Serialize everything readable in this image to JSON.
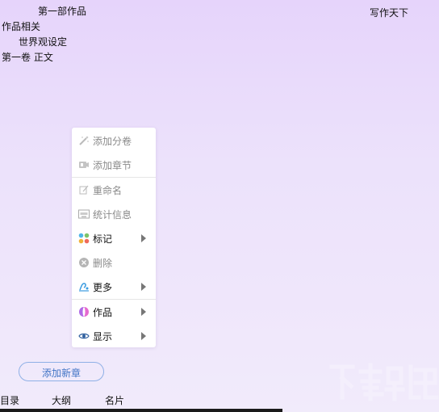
{
  "header": {
    "book_title": "第一部作品",
    "app_name": "写作天下"
  },
  "tree": {
    "items": [
      {
        "label": "作品相关"
      },
      {
        "label": "世界观设定"
      },
      {
        "label": "第一卷 正文"
      }
    ]
  },
  "context_menu": {
    "items": [
      {
        "label": "添加分卷",
        "icon": "add-volume-icon",
        "enabled": false
      },
      {
        "label": "添加章节",
        "icon": "add-chapter-icon",
        "enabled": false
      },
      {
        "label": "重命名",
        "icon": "rename-icon",
        "enabled": false
      },
      {
        "label": "统计信息",
        "icon": "statistics-icon",
        "enabled": false
      },
      {
        "label": "标记",
        "icon": "color-dots-icon",
        "enabled": true,
        "submenu": true
      },
      {
        "label": "删除",
        "icon": "delete-icon",
        "enabled": false
      },
      {
        "label": "更多",
        "icon": "more-icon",
        "enabled": true,
        "submenu": true
      },
      {
        "label": "作品",
        "icon": "works-icon",
        "enabled": true,
        "submenu": true
      },
      {
        "label": "显示",
        "icon": "eye-icon",
        "enabled": true,
        "submenu": true
      }
    ]
  },
  "actions": {
    "add_chapter_button": "添加新章"
  },
  "bottom_tabs": [
    {
      "label": "目录"
    },
    {
      "label": "大纲"
    },
    {
      "label": "名片"
    }
  ],
  "colors": {
    "accent": "#3f73c5",
    "background_top": "#e6d4fb",
    "background_bottom": "#f1ebfb"
  }
}
